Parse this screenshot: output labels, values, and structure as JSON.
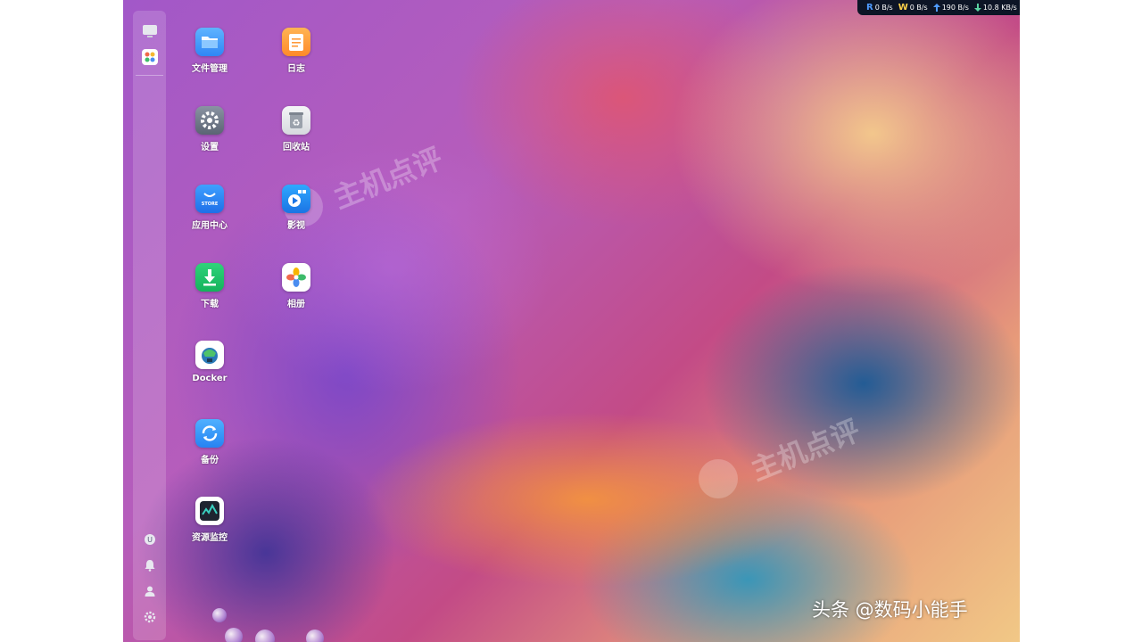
{
  "status_bar": {
    "read": {
      "letter": "R",
      "value": "0 B/s"
    },
    "write": {
      "letter": "W",
      "value": "0 B/s"
    },
    "upload": {
      "value": "190 B/s"
    },
    "download": {
      "value": "10.8 KB/s"
    }
  },
  "apps": [
    {
      "label": "文件管理",
      "icon": "folder-icon"
    },
    {
      "label": "日志",
      "icon": "notes-icon"
    },
    {
      "label": "设置",
      "icon": "gear-icon"
    },
    {
      "label": "回收站",
      "icon": "recycle-bin-icon"
    },
    {
      "label": "应用中心",
      "icon": "store-icon",
      "badge": "STORE"
    },
    {
      "label": "影视",
      "icon": "video-icon"
    },
    {
      "label": "下载",
      "icon": "download-icon"
    },
    {
      "label": "相册",
      "icon": "photos-icon"
    },
    {
      "label": "Docker",
      "icon": "docker-icon"
    },
    {
      "label": "备份",
      "icon": "backup-icon"
    },
    {
      "label": "资源监控",
      "icon": "monitor-icon"
    }
  ],
  "watermark": {
    "text": "主机点评"
  },
  "credit": {
    "text": "头条 @数码小能手"
  }
}
